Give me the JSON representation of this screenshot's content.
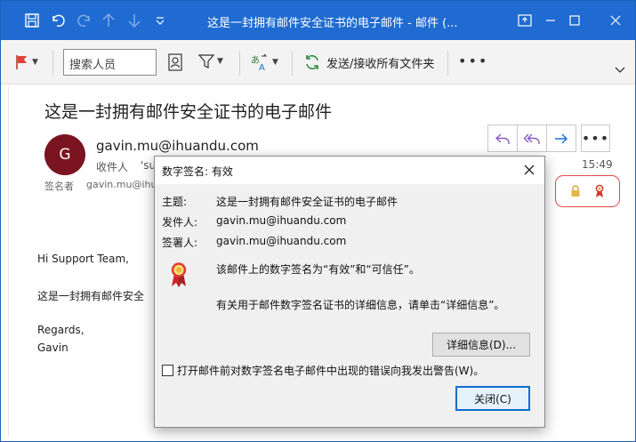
{
  "window": {
    "title": "这是一封拥有邮件安全证书的电子邮件  -  邮件 (..."
  },
  "ribbon": {
    "search_placeholder": "搜索人员",
    "send_receive_label": "发送/接收所有文件夹"
  },
  "message": {
    "subject": "这是一封拥有邮件安全证书的电子邮件",
    "avatar_initial": "G",
    "from": "gavin.mu@ihuandu.com",
    "to_label": "收件人",
    "to_value": "'su",
    "signer_label": "签名者",
    "signer_value": "gavin.mu@ihu",
    "time": "15:49",
    "body": {
      "greeting": "Hi Support Team,",
      "line1": "这是一封拥有邮件安全",
      "closing": "Regards,",
      "name": "Gavin"
    }
  },
  "dialog": {
    "title": "数字签名: 有效",
    "subject_label": "主题:",
    "subject_value": "这是一封拥有邮件安全证书的电子邮件",
    "sender_label": "发件人:",
    "sender_value": "gavin.mu@ihuandu.com",
    "signer_label": "签署人:",
    "signer_value": "gavin.mu@ihuandu.com",
    "status_text": "该邮件上的数字签名为“有效”和“可信任”。",
    "details_text": "有关用于邮件数字签名证书的详细信息，请单击“详细信息”。",
    "details_button": "详细信息(D)...",
    "warn_checkbox_label": "打开邮件前对数字签名电子邮件中出现的错误向我发出警告(W)。",
    "warn_checked": false,
    "close_button": "关闭(C)"
  },
  "colors": {
    "titlebar": "#1f6bd1",
    "avatar": "#7a1420",
    "badge_border": "#e34b4b",
    "accent_purple": "#8a5cc4"
  }
}
